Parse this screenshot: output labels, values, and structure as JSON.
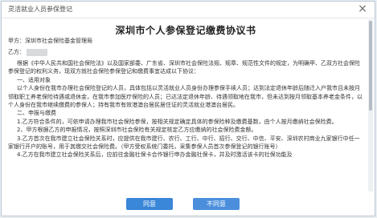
{
  "window": {
    "title": "灵活就业人员参保登记",
    "close_glyph": "×"
  },
  "document": {
    "title": "深圳市个人参保登记缴费协议书",
    "party_a": "甲方：深圳市社会保险基金管理局",
    "party_b_label": "乙方：",
    "paragraphs": [
      "根据《中华人民共和国社会保险法》以及国家部委、广东省、深圳市社会保险法规、规章、规范性文件的规定，为明确甲、乙双方社会保险参保登记的权利义务，现双方就社会保险参保登记和缴费事宜达成以下协议：",
      "一、适用对象",
      "以个人身份在我市办理社会保险登记的人员，具体包括以灵活就业人员身份办理参保手续人员；达到法定退休年龄后随迁入户我市且未按月领取职工养老保险待遇或退休金，在我市参加医疗保险的人员；已达法定退休年龄、待遇领取地在我市，但未达到按月领取基本养老金条件，以个人身份在我市继续缴费的参保人；持有我市有效港澳台居民居住证的灵活就业港澳台居民。",
      "二、申报与缴费",
      "1.乙方符合条件的，可依申请办理我市社会保险参保，按相关规定确定具体的参保险种及缴费基数，由个人按月缴纳社会保险费。",
      "2、甲方根据乙方的申报情况，按照深圳市社会保险有关规定核定乙方应缴纳的社会保险费金额。",
      "3.乙方首次在我市建立社会保险关系时，应提供在我市建行、农行、工行、中行、招行、交行、中信、平安、深圳农村商业九家银行中任一家银行开户的账号，用于其缴交社会保险费。（甲方受权系统门委托，采集参保人员首次参保登记的银行账号）",
      "4.乙方在我市建立社会保险关系后，应前往金融社保卡合作银行申办金融社保卡，并及时激活该卡的社保功能及"
    ]
  },
  "buttons": {
    "agree": "同意",
    "disagree": "不同意"
  },
  "colors": {
    "accent": "#3a86d8"
  }
}
